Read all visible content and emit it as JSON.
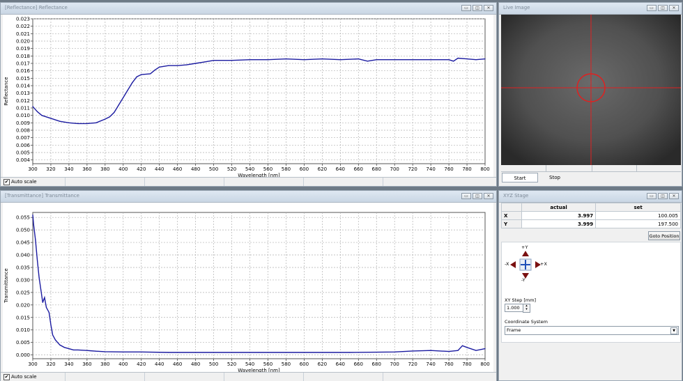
{
  "reflectance_window": {
    "title": "[Reflectance] Reflectance",
    "auto_scale_label": "Auto scale",
    "auto_scale_checked": true
  },
  "transmittance_window": {
    "title": "[Transmittance] Transmittance",
    "auto_scale_label": "Auto scale",
    "auto_scale_checked": true
  },
  "live_image_window": {
    "title": "Live Image",
    "start_label": "Start",
    "stop_label": "Stop",
    "crosshair_color": "#e02020"
  },
  "xyz_stage_window": {
    "title": "XYZ Stage",
    "columns": [
      "actual",
      "set"
    ],
    "rows": [
      {
        "axis": "X",
        "actual": "3.997",
        "set": "100.005"
      },
      {
        "axis": "Y",
        "actual": "3.999",
        "set": "197.500"
      }
    ],
    "goto_label": "Goto Position",
    "jog": {
      "up": "+Y",
      "down": "-Y",
      "left": "-X",
      "right": "+X"
    },
    "xy_step_label": "XY Step [mm]",
    "xy_step_value": "1.000",
    "coord_system_label": "Coordinate System",
    "coord_system_value": "Frame"
  },
  "window_buttons": {
    "minimize": "▭",
    "restore": "◫",
    "close": "✕"
  },
  "line_color": "#1a1aa0",
  "chart_data": [
    {
      "type": "line",
      "title": "",
      "xlabel": "Wavelength [nm]",
      "ylabel": "Reflectance",
      "xlim": [
        300,
        800
      ],
      "ylim": [
        0.0035,
        0.023
      ],
      "x_ticks": [
        300,
        320,
        340,
        360,
        380,
        400,
        420,
        440,
        460,
        480,
        500,
        520,
        540,
        560,
        580,
        600,
        620,
        640,
        660,
        680,
        700,
        720,
        740,
        760,
        780,
        800
      ],
      "y_ticks": [
        0.004,
        0.005,
        0.006,
        0.007,
        0.008,
        0.009,
        0.01,
        0.011,
        0.012,
        0.013,
        0.014,
        0.015,
        0.016,
        0.017,
        0.018,
        0.019,
        0.02,
        0.021,
        0.022,
        0.023
      ],
      "y_tick_labels": [
        "0.004",
        "0.005",
        "0.006",
        "0.007",
        "0.008",
        "0.009",
        "0.010",
        "0.011",
        "0.012",
        "0.013",
        "0.014",
        "0.015",
        "0.016",
        "0.017",
        "0.018",
        "0.019",
        "0.020",
        "0.021",
        "0.022",
        "0.023"
      ],
      "grid": true,
      "series": [
        {
          "x": [
            300,
            305,
            310,
            320,
            330,
            340,
            350,
            360,
            370,
            380,
            385,
            390,
            395,
            400,
            405,
            410,
            415,
            420,
            430,
            435,
            440,
            450,
            460,
            470,
            480,
            490,
            500,
            520,
            540,
            560,
            580,
            600,
            620,
            640,
            660,
            670,
            680,
            700,
            720,
            740,
            760,
            765,
            770,
            780,
            790,
            800
          ],
          "y": [
            0.0112,
            0.0105,
            0.01,
            0.0096,
            0.0092,
            0.009,
            0.0089,
            0.0089,
            0.009,
            0.0095,
            0.0098,
            0.0104,
            0.0114,
            0.0124,
            0.0134,
            0.0144,
            0.0152,
            0.0155,
            0.0156,
            0.0161,
            0.0165,
            0.0167,
            0.0167,
            0.0168,
            0.017,
            0.0172,
            0.0174,
            0.0174,
            0.0175,
            0.0175,
            0.0176,
            0.0175,
            0.0176,
            0.0175,
            0.0176,
            0.0173,
            0.0175,
            0.0175,
            0.0175,
            0.0175,
            0.0175,
            0.0173,
            0.0177,
            0.0176,
            0.0175,
            0.0176
          ]
        }
      ]
    },
    {
      "type": "line",
      "title": "",
      "xlabel": "Wavelength [nm]",
      "ylabel": "Transmittance",
      "xlim": [
        300,
        800
      ],
      "ylim": [
        -0.0015,
        0.057
      ],
      "x_ticks": [
        300,
        320,
        340,
        360,
        380,
        400,
        420,
        440,
        460,
        480,
        500,
        520,
        540,
        560,
        580,
        600,
        620,
        640,
        660,
        680,
        700,
        720,
        740,
        760,
        780,
        800
      ],
      "y_ticks": [
        0.0,
        0.005,
        0.01,
        0.015,
        0.02,
        0.025,
        0.03,
        0.035,
        0.04,
        0.045,
        0.05,
        0.055
      ],
      "y_tick_labels": [
        "0.000",
        "0.005",
        "0.010",
        "0.015",
        "0.020",
        "0.025",
        "0.030",
        "0.035",
        "0.040",
        "0.045",
        "0.050",
        "0.055"
      ],
      "grid": true,
      "series": [
        {
          "x": [
            300,
            301,
            303,
            305,
            307,
            309,
            311,
            313,
            315,
            318,
            320,
            322,
            325,
            330,
            335,
            340,
            345,
            350,
            360,
            370,
            380,
            400,
            420,
            450,
            500,
            550,
            600,
            650,
            700,
            720,
            740,
            760,
            770,
            775,
            780,
            790,
            800
          ],
          "y": [
            0.056,
            0.052,
            0.046,
            0.038,
            0.031,
            0.026,
            0.021,
            0.023,
            0.019,
            0.017,
            0.012,
            0.008,
            0.006,
            0.004,
            0.003,
            0.0025,
            0.002,
            0.002,
            0.0018,
            0.0015,
            0.0013,
            0.0012,
            0.0012,
            0.001,
            0.001,
            0.001,
            0.001,
            0.001,
            0.0012,
            0.0016,
            0.0018,
            0.0014,
            0.0018,
            0.0037,
            0.003,
            0.0018,
            0.0025
          ]
        }
      ]
    }
  ]
}
